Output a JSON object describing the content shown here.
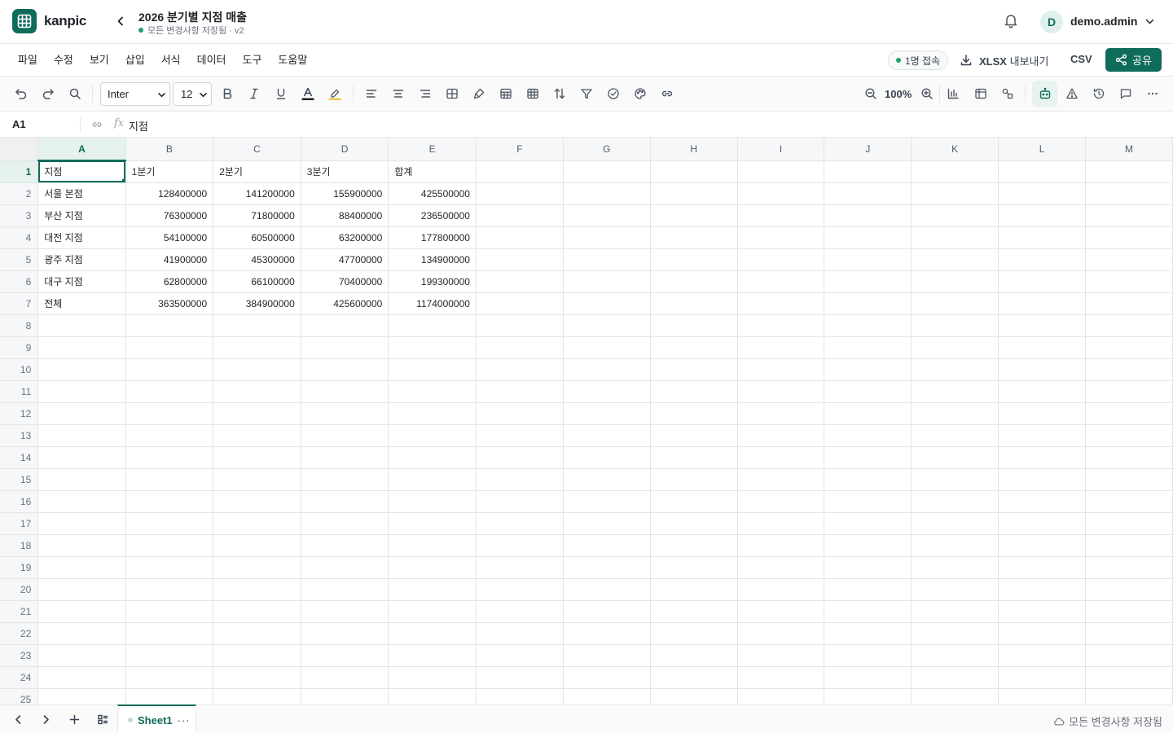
{
  "app": {
    "brand": "kanpic",
    "doc_title": "2026 분기별 지점 매출",
    "doc_status": "모든 변경사항 저장됨 · v2",
    "user_initial": "D",
    "username": "demo.admin"
  },
  "menu": [
    "파일",
    "수정",
    "보기",
    "삽입",
    "서식",
    "데이터",
    "도구",
    "도움말"
  ],
  "actions": {
    "presence": "1명 접속",
    "export_xlsx_bold": "XLSX",
    "export_xlsx_rest": "내보내기",
    "export_csv": "CSV",
    "share": "공유"
  },
  "toolbar": {
    "font": "Inter",
    "font_size": "12",
    "zoom": "100%",
    "icons": [
      "undo-icon",
      "redo-icon",
      "search-icon",
      "bold-icon",
      "italic-icon",
      "underline-icon",
      "text-color-icon",
      "highlight-icon",
      "align-left-icon",
      "align-center-icon",
      "align-right-icon",
      "merge-cells-icon",
      "paint-format-icon",
      "borders-icon",
      "table-icon",
      "sort-icon",
      "filter-icon",
      "validation-icon",
      "palette-icon",
      "link-icon",
      "zoom-out-icon",
      "zoom-in-icon",
      "chart-icon",
      "pivot-icon",
      "shapes-icon",
      "ai-assistant-icon",
      "warning-icon",
      "history-icon",
      "comment-icon",
      "more-icon"
    ]
  },
  "formula_bar": {
    "cell_ref": "A1",
    "fx": "fx",
    "value": "지점"
  },
  "grid": {
    "columns": [
      "A",
      "B",
      "C",
      "D",
      "E",
      "F",
      "G",
      "H",
      "I",
      "J",
      "K",
      "L",
      "M"
    ],
    "active_column": "A",
    "active_row": 1,
    "row_count": 25,
    "rows": [
      [
        "지점",
        "1분기",
        "2분기",
        "3분기",
        "합계"
      ],
      [
        "서울 본점",
        "128400000",
        "141200000",
        "155900000",
        "425500000"
      ],
      [
        "부산 지점",
        "76300000",
        "71800000",
        "88400000",
        "236500000"
      ],
      [
        "대전 지점",
        "54100000",
        "60500000",
        "63200000",
        "177800000"
      ],
      [
        "광주 지점",
        "41900000",
        "45300000",
        "47700000",
        "134900000"
      ],
      [
        "대구 지점",
        "62800000",
        "66100000",
        "70400000",
        "199300000"
      ],
      [
        "전체",
        "363500000",
        "384900000",
        "425600000",
        "1174000000"
      ]
    ]
  },
  "footer": {
    "sheet_name": "Sheet1",
    "sheet_more": "···",
    "save_status": "모든 변경사항 저장됨"
  },
  "colors": {
    "accent": "#0f6b5a",
    "accent_light": "#e4f1ec",
    "status_green": "#22a06b"
  }
}
